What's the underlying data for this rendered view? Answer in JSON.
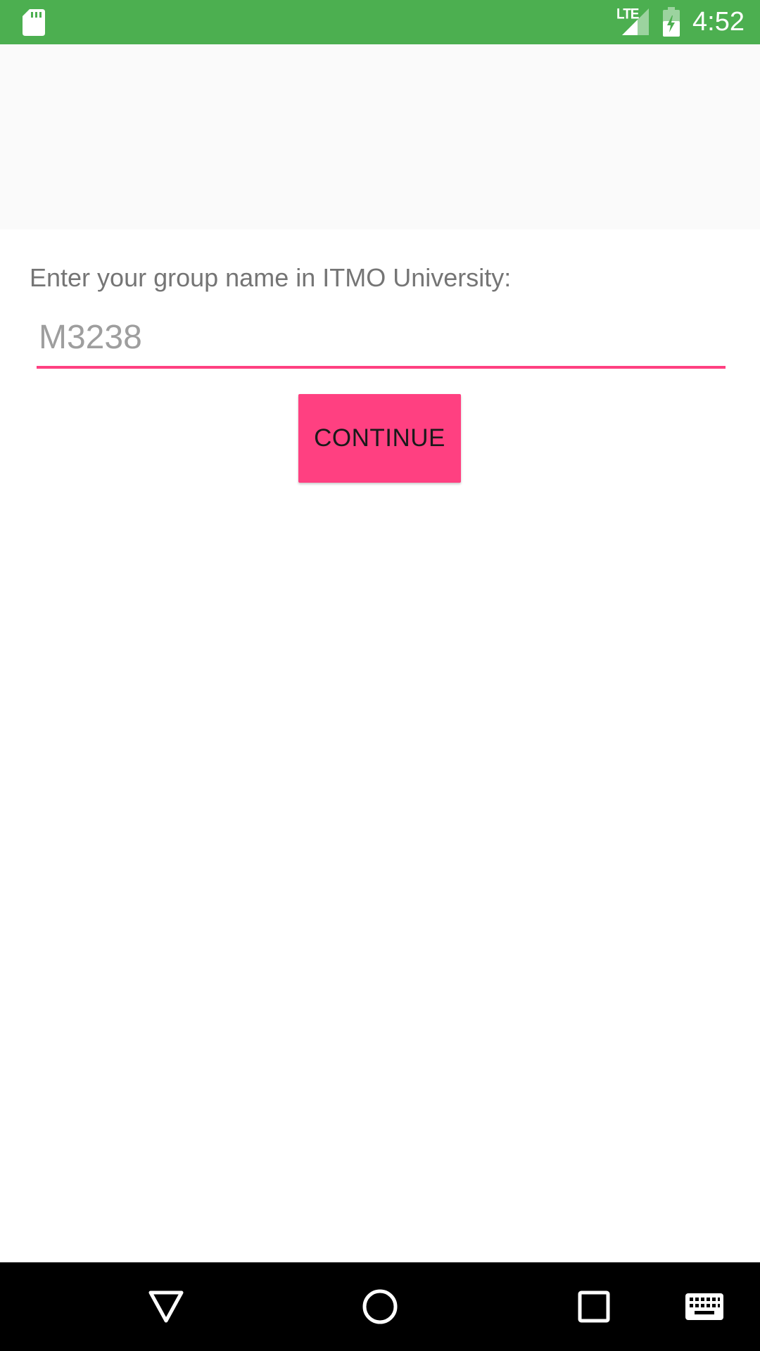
{
  "status_bar": {
    "time": "4:52",
    "network": "LTE",
    "background_color": "#4caf50",
    "icons": [
      "sd-card-icon",
      "signal-icon",
      "battery-charging-icon"
    ]
  },
  "main": {
    "prompt": "Enter your group name in ITMO University:",
    "group_input": {
      "value": "",
      "placeholder": "M3238"
    },
    "continue_label": "CONTINUE",
    "accent_color": "#ff4081"
  },
  "nav_bar": {
    "icons": [
      "back-icon",
      "home-icon",
      "recents-icon",
      "keyboard-icon"
    ]
  }
}
